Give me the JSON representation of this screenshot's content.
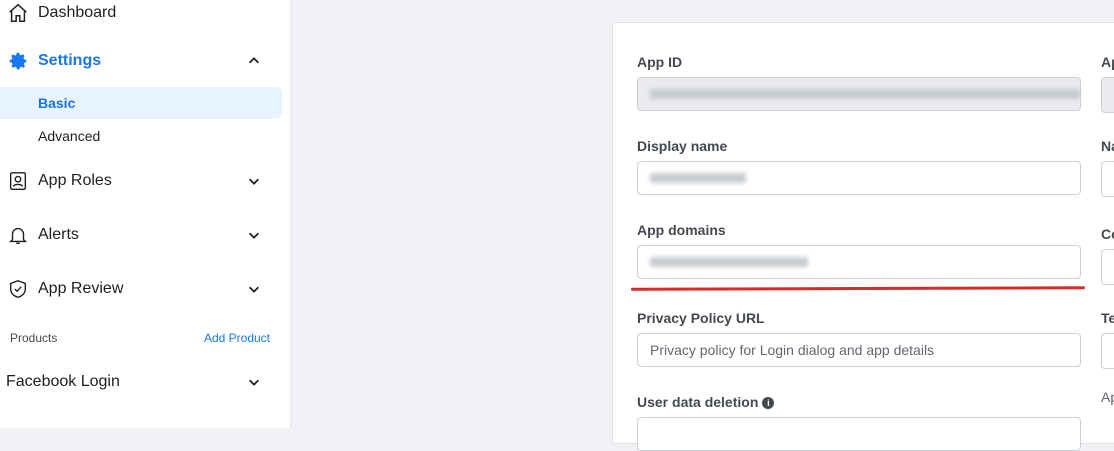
{
  "sidebar": {
    "dashboard": "Dashboard",
    "settings": "Settings",
    "settings_sub": [
      "Basic",
      "Advanced"
    ],
    "app_roles": "App Roles",
    "alerts": "Alerts",
    "app_review": "App Review",
    "products_label": "Products",
    "add_product": "Add Product",
    "facebook_login": "Facebook Login"
  },
  "form": {
    "app_id_label": "App ID",
    "display_name_label": "Display name",
    "app_domains_label": "App domains",
    "privacy_policy_label": "Privacy Policy URL",
    "privacy_policy_placeholder": "Privacy policy for Login dialog and app details",
    "user_data_deletion_label": "User data deletion",
    "right_col_labels": [
      "Ap",
      "Na",
      "Co",
      "Te",
      "Ap"
    ]
  },
  "colors": {
    "accent": "#1877f2",
    "active_bg": "#e7f3ff",
    "highlight_underline": "#d42b2b"
  }
}
